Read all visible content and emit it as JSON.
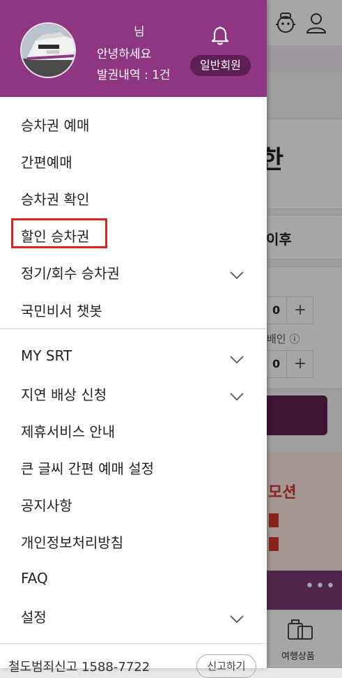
{
  "user": {
    "name_suffix": "님",
    "greeting": "안녕하세요",
    "tickets": "발권내역 : 1건",
    "member_type": "일반회원"
  },
  "menu_primary": [
    {
      "label": "승차권 예매"
    },
    {
      "label": "간편예매"
    },
    {
      "label": "승차권 확인"
    },
    {
      "label": "할인 승차권"
    },
    {
      "label": "정기/회수 승차권"
    },
    {
      "label": "국민비서 챗봇"
    }
  ],
  "menu_secondary": [
    {
      "label": "MY SRT"
    },
    {
      "label": "지연 배상 신청"
    },
    {
      "label": "제휴서비스 안내"
    },
    {
      "label": "큰 글씨 간편 예매 설정"
    },
    {
      "label": "공지사항"
    },
    {
      "label": "개인정보처리방침"
    },
    {
      "label": "FAQ"
    },
    {
      "label": "설정"
    }
  ],
  "footer": {
    "report_text": "철도범죄신고 1588-7722",
    "report_button": "신고하기"
  },
  "background": {
    "big_char": "한",
    "after_text": "이후",
    "counter1": "0",
    "counter2": "0",
    "plus": "+",
    "discount_label": "배인",
    "promo_text": "모션",
    "dots": "•••",
    "nav_label": "여행상품"
  },
  "colors": {
    "header": "#8f3683",
    "badge": "#5e1f53",
    "highlight": "#e0201f"
  },
  "icons": [
    "bell-icon",
    "chevron-down-icon",
    "robot-icon",
    "user-icon",
    "luggage-icon",
    "info-icon"
  ]
}
